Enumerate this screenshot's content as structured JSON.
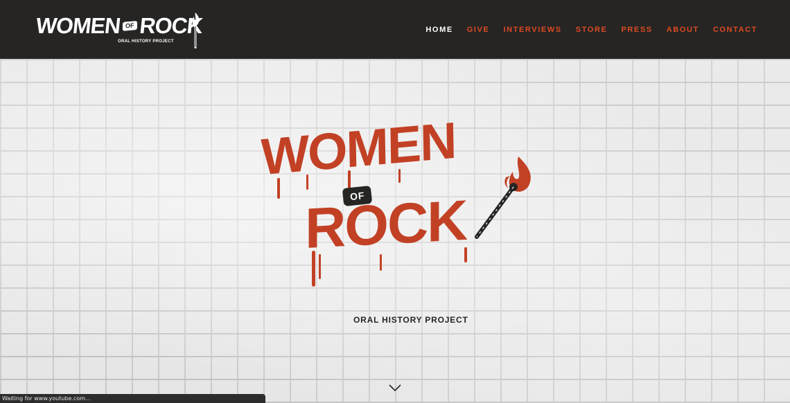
{
  "site": {
    "logo_word_1": "WOMEN",
    "logo_of": "OF",
    "logo_word_2": "ROCK",
    "logo_tagline": "ORAL HISTORY PROJECT"
  },
  "nav": {
    "items": [
      {
        "label": "HOME"
      },
      {
        "label": "GIVE"
      },
      {
        "label": "INTERVIEWS"
      },
      {
        "label": "STORE"
      },
      {
        "label": "PRESS"
      },
      {
        "label": "ABOUT"
      },
      {
        "label": "CONTACT"
      }
    ],
    "active": "HOME"
  },
  "hero": {
    "word_1": "WOMEN",
    "of": "OF",
    "word_2": "ROCK",
    "tagline": "ORAL HISTORY PROJECT"
  },
  "status_bar": {
    "text": "Waiting for www.youtube.com..."
  },
  "icons": {
    "header_match": "flaming-match-icon",
    "hero_match": "flaming-match-icon",
    "scroll": "chevron-down-icon"
  },
  "colors": {
    "header_bg": "#262524",
    "accent": "#dd4a22",
    "logo_red": "#c24125",
    "nav_active": "#ffffff"
  }
}
